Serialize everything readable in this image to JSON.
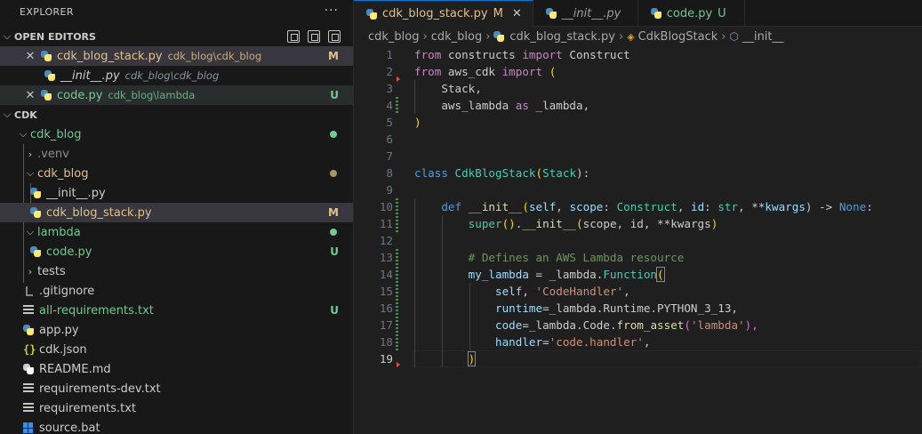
{
  "explorer": {
    "title": "EXPLORER",
    "more": "···",
    "open_editors_label": "OPEN EDITORS",
    "open_editors": [
      {
        "name": "cdk_blog_stack.py",
        "path": "cdk_blog\\cdk_blog",
        "badge": "M",
        "close": "✕"
      },
      {
        "name": "__init__.py",
        "path": "cdk_blog\\cdk_blog",
        "badge": ""
      },
      {
        "name": "code.py",
        "path": "cdk_blog\\lambda",
        "badge": "U",
        "close": "✕"
      }
    ],
    "root_label": "CDK",
    "tree": [
      {
        "name": "cdk_blog"
      },
      {
        "name": ".venv"
      },
      {
        "name": "cdk_blog"
      },
      {
        "name": "__init__.py"
      },
      {
        "name": "cdk_blog_stack.py",
        "badge": "M"
      },
      {
        "name": "lambda"
      },
      {
        "name": "code.py",
        "badge": "U"
      },
      {
        "name": "tests"
      },
      {
        "name": ".gitignore"
      },
      {
        "name": "all-requirements.txt",
        "badge": "U"
      },
      {
        "name": "app.py"
      },
      {
        "name": "cdk.json"
      },
      {
        "name": "README.md"
      },
      {
        "name": "requirements-dev.txt"
      },
      {
        "name": "requirements.txt"
      },
      {
        "name": "source.bat"
      }
    ]
  },
  "tabs": [
    {
      "label": "cdk_blog_stack.py",
      "badge": "M",
      "close": "✕"
    },
    {
      "label": "__init__.py",
      "badge": ""
    },
    {
      "label": "code.py",
      "badge": "U"
    }
  ],
  "breadcrumb": [
    "cdk_blog",
    "cdk_blog",
    "cdk_blog_stack.py",
    "CdkBlogStack",
    "__init__"
  ],
  "code": {
    "line_numbers": [
      "1",
      "2",
      "3",
      "4",
      "5",
      "6",
      "7",
      "8",
      "9",
      "10",
      "11",
      "12",
      "13",
      "14",
      "15",
      "16",
      "17",
      "18",
      "19"
    ],
    "tokens": {
      "l1": [
        "from",
        " constructs ",
        "import",
        " Construct"
      ],
      "l2": [
        "from",
        " aws_cdk ",
        "import",
        " ",
        "("
      ],
      "l3": [
        "    Stack,"
      ],
      "l4": [
        "    aws_lambda ",
        "as",
        " _lambda,"
      ],
      "l5": [
        ")"
      ],
      "l8": [
        "class",
        " ",
        "CdkBlogStack",
        "(",
        "Stack",
        "):"
      ],
      "l10": [
        "    ",
        "def",
        " ",
        "__init__",
        "(",
        "self",
        ", ",
        "scope",
        ": ",
        "Construct",
        ", ",
        "id",
        ": ",
        "str",
        ", **",
        "kwargs",
        ") -> ",
        "None",
        ":"
      ],
      "l11": [
        "        ",
        "super",
        "()",
        ".",
        "__init__",
        "(",
        "scope, id, **kwargs",
        ")"
      ],
      "l13": [
        "        # Defines an AWS Lambda resource"
      ],
      "l14": [
        "        ",
        "my_lambda",
        " = ",
        "_lambda",
        ".",
        "Function",
        "("
      ],
      "l15": [
        "            ",
        "self",
        ", ",
        "'CodeHandler'",
        ","
      ],
      "l16": [
        "            ",
        "runtime",
        "=",
        "_lambda",
        ".",
        "Runtime",
        ".",
        "PYTHON_3_13",
        ","
      ],
      "l17": [
        "            ",
        "code",
        "=",
        "_lambda",
        ".",
        "Code",
        ".",
        "from_asset",
        "(",
        "'lambda'",
        "),"
      ],
      "l18": [
        "            ",
        "handler",
        "=",
        "'code.handler'",
        ","
      ],
      "l19": [
        "        ",
        ")"
      ]
    }
  },
  "colors": {
    "modified": "#e2c08d",
    "untracked": "#73c991",
    "accent": "#0078d4"
  }
}
